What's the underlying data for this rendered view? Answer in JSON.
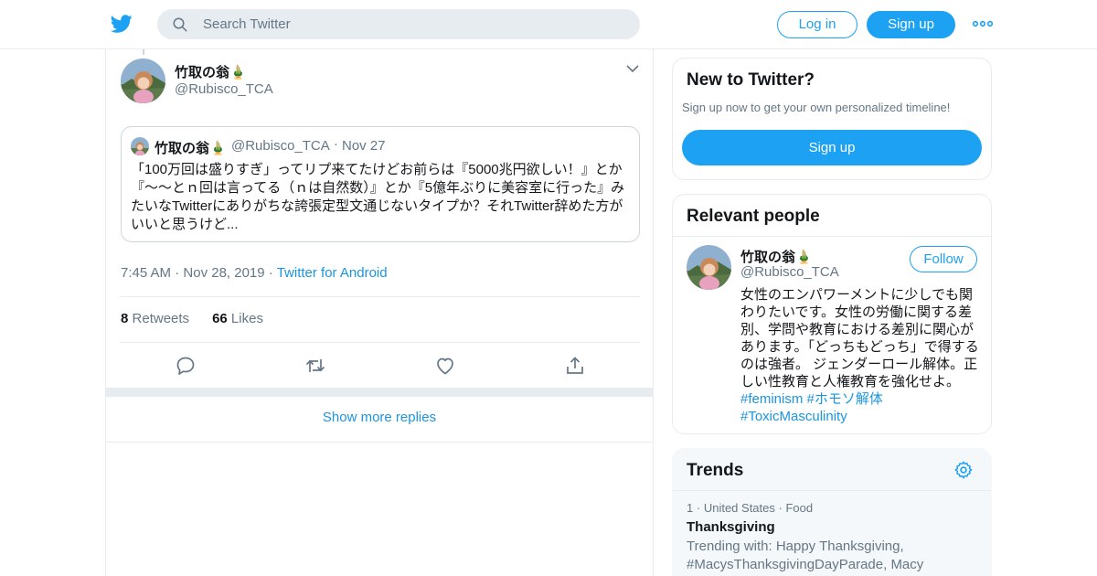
{
  "header": {
    "search_placeholder": "Search Twitter",
    "login_label": "Log in",
    "signup_label": "Sign up"
  },
  "tweet": {
    "author_name": "竹取の翁🎍",
    "author_handle": "@Rubisco_TCA",
    "quoted": {
      "name": "竹取の翁🎍",
      "handle": "@Rubisco_TCA",
      "separator": "·",
      "date": "Nov 27",
      "text": "「100万回は盛りすぎ」ってリプ来てたけどお前らは『5000兆円欲しい！』とか『～〜とｎ回は言ってる（ｎは自然数）』とか『5億年ぶりに美容室に行った』みたいなTwitterにありがちな誇張定型文通じないタイプか？それTwitter辞めた方がいいと思うけど..."
    },
    "time": "7:45 AM",
    "date": "Nov 28, 2019",
    "source": "Twitter for Android",
    "separator": "·",
    "retweets_count": "8",
    "retweets_label": "Retweets",
    "likes_count": "66",
    "likes_label": "Likes",
    "show_more": "Show more replies"
  },
  "sidebar": {
    "new_to_twitter": {
      "title": "New to Twitter?",
      "subtitle": "Sign up now to get your own personalized timeline!",
      "button": "Sign up"
    },
    "relevant_people": {
      "title": "Relevant people",
      "name": "竹取の翁🎍",
      "handle": "@Rubisco_TCA",
      "follow_label": "Follow",
      "bio": "女性のエンパワーメントに少しでも関わりたいです。女性の労働に関する差別、学問や教育における差別に関心があります。「どっちもどっち」で得するのは強者。 ジェンダーロール解体。正しい性教育と人権教育を強化せよ。",
      "hashtags": [
        "#feminism",
        "#ホモソ解体",
        "#ToxicMasculinity"
      ]
    },
    "trends": {
      "title": "Trends",
      "items": [
        {
          "rank": "1",
          "location": "United States",
          "category": "Food",
          "separator": "·",
          "name": "Thanksgiving",
          "trending_with": "Trending with: Happy Thanksgiving, #MacysThanksgivingDayParade, Macy"
        }
      ]
    }
  },
  "colors": {
    "accent": "#1da1f2",
    "link": "#1b95e0",
    "muted": "#657786",
    "border": "#e6ecf0"
  },
  "icons": [
    "twitter-bird-icon",
    "search-icon",
    "more-dots-icon",
    "chevron-down-icon",
    "reply-icon",
    "retweet-icon",
    "like-icon",
    "share-icon",
    "gear-icon"
  ]
}
